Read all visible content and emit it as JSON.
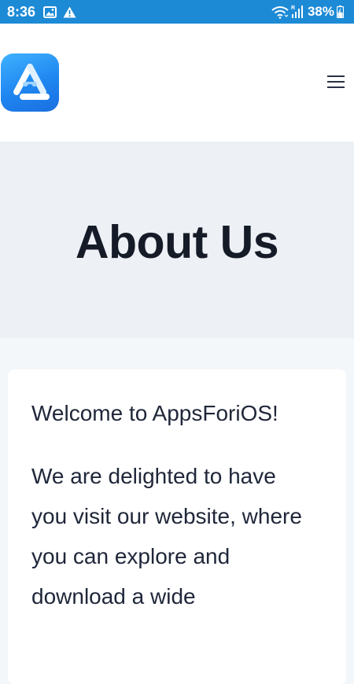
{
  "status_bar": {
    "time": "8:36",
    "battery": "38%",
    "left_icons": [
      "image-icon",
      "warning-icon"
    ],
    "right_icons": [
      "wifi-icon",
      "signal-icon",
      "battery-icon"
    ],
    "color": "#1d8ad6"
  },
  "header": {
    "logo_icon": "appsforios-logo-icon",
    "menu_icon": "hamburger-menu-icon"
  },
  "hero": {
    "title": "About Us"
  },
  "content": {
    "welcome": "Welcome to AppsForiOS!",
    "intro": "We are delighted to have you visit our website, where you can explore and download a wide"
  },
  "colors": {
    "accent": "#1f86f0",
    "hero_background": "#edf1f5",
    "text": "#20273a"
  }
}
